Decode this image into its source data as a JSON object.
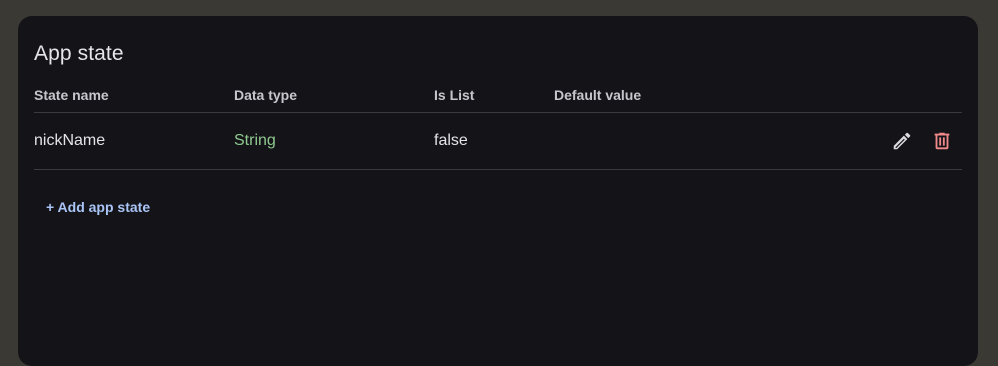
{
  "panel": {
    "title": "App state"
  },
  "table": {
    "headers": [
      "State name",
      "Data type",
      "Is List",
      "Default value"
    ],
    "rows": [
      {
        "state_name": "nickName",
        "data_type": "String",
        "is_list": "false",
        "default_value": ""
      }
    ]
  },
  "actions": {
    "edit_icon": "pencil-icon",
    "delete_icon": "trash-icon"
  },
  "add_button": {
    "label": "+ Add app state"
  },
  "colors": {
    "background": "#3a3934",
    "panel": "#141418",
    "type_string": "#8fc98f",
    "delete": "#f08a8a",
    "link": "#a9c4f5"
  }
}
